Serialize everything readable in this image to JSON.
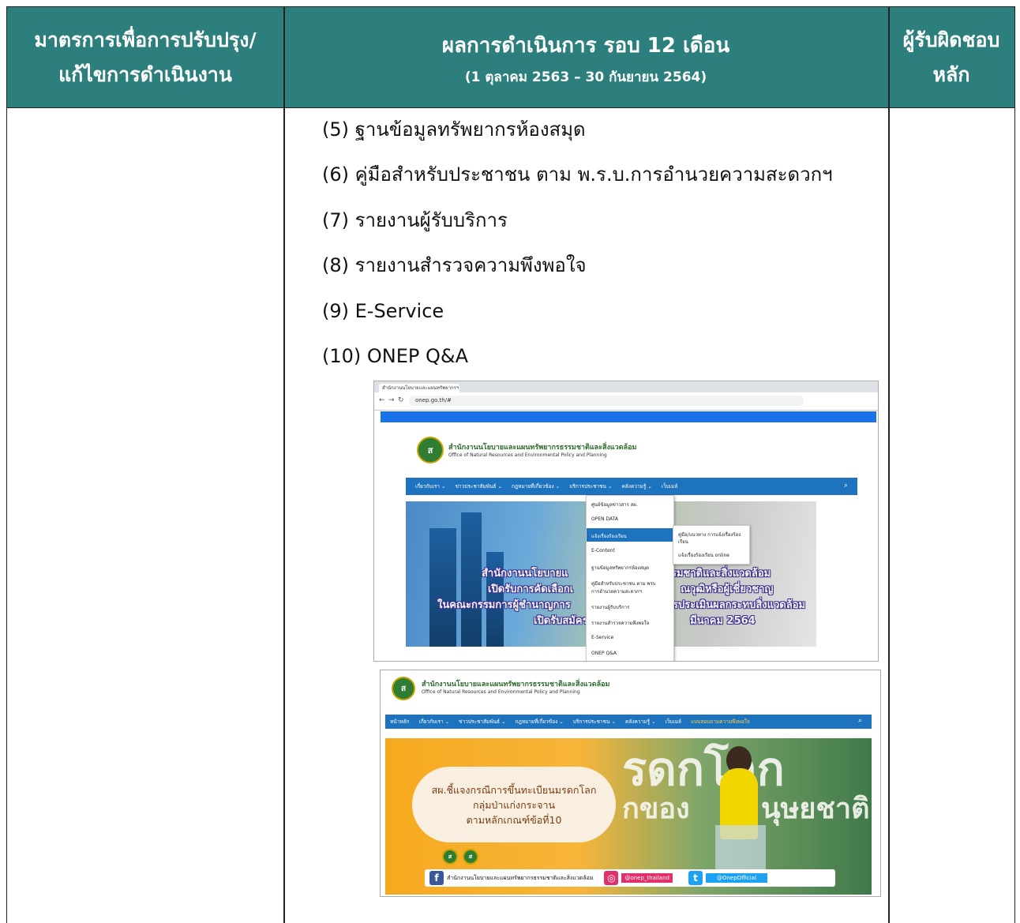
{
  "header": {
    "col1_line1": "มาตรการเพื่อการปรับปรุง/",
    "col1_line2": "แก้ไขการดำเนินงาน",
    "col2_title": "ผลการดำเนินการ รอบ 12 เดือน",
    "col2_sub": "(1 ตุลาคม 2563 – 30 กันยายน 2564)",
    "col3_line1": "ผู้รับผิดชอบ",
    "col3_line2": "หลัก"
  },
  "items": [
    "(5) ฐานข้อมูลทรัพยากรห้องสมุด",
    "(6) คู่มือสำหรับประชาชน ตาม พ.ร.บ.การอำนวยความสะดวกฯ",
    "(7) รายงานผู้รับบริการ",
    "(8) รายงานสำรวจความพึงพอใจ",
    "(9) E-Service",
    "(10) ONEP Q&A"
  ],
  "shot1": {
    "tab_title": "สำนักงานนโยบายและแผนทรัพยากรฯ",
    "url": "onep.go.th/#",
    "org_th": "สำนักงานนโยบายและแผนทรัพยากรธรรมชาติและสิ่งแวดล้อม",
    "org_en": "Office of Natural Resources and Environmental Policy and Planning",
    "menu": [
      "เกี่ยวกับเรา ⌄",
      "ข่าวประชาสัมพันธ์ ⌄",
      "กฎหมายที่เกี่ยวข้อง ⌄",
      "บริการประชาชน ⌄",
      "คลังความรู้ ⌄",
      "เว็บเมล์"
    ],
    "dropdown": [
      "ศูนย์ข้อมูลข่าวสาร สผ.",
      "OPEN DATA",
      "แจ้งเรื่องร้องเรียน",
      "E-Content",
      "ฐานข้อมูลทรัพยากรห้องสมุด",
      "คู่มือสำหรับประชาชน ตาม พรบ",
      "การอำนวยความสะดวกฯ",
      "รายงานผู้รับบริการ",
      "รายงานสำรวจความพึงพอใจ",
      "E-Service",
      "ONEP Q&A"
    ],
    "submenu": [
      "คู่มือ/แนวทาง การแจ้งเรื่องร้อง",
      "เรียน",
      "แจ้งเรื่องร้องเรียน online"
    ],
    "banner_lines": [
      "สำนักงานนโยบายแ",
      "เปิดรับการคัดเลือกเ",
      "ในคณะกรรมการผู้ชำนาญการ",
      "เปิดรับสมัคร",
      "รมชาติและสิ่งแวดล้อม",
      "ณวุฒิหรือผู้เชี่ยวชาญ",
      "รประเมินผลกระทบสิ่งแวดล้อม",
      "มีนาคม 2564"
    ]
  },
  "shot2": {
    "org_th": "สำนักงานนโยบายและแผนทรัพยากรธรรมชาติและสิ่งแวดล้อม",
    "org_en": "Office of Natural Resources and Environmental Policy and Planning",
    "menu": [
      "หน้าหลัก",
      "เกี่ยวกับเรา ⌄",
      "ข่าวประชาสัมพันธ์ ⌄",
      "กฎหมายที่เกี่ยวข้อง ⌄",
      "บริการประชาชน ⌄",
      "คลังความรู้ ⌄",
      "เว็บเมล์",
      "แบบสอบถามความพึงพอใจ"
    ],
    "bubble": [
      "สผ.ชี้แจงกรณีการขึ้นทะเบียนมรดกโลก",
      "กลุ่มป่าแก่งกระจาน",
      "ตามหลักเกณฑ์ข้อที่10"
    ],
    "bg_word1": "รดกโลก",
    "bg_word2": "กของ",
    "bg_word3": "นุษยชาติ",
    "fb_text": "สำนักงานนโยบายและแผนทรัพยากรธรรมชาติและสิ่งแวดล้อม",
    "ig_text": "@onep_thailand",
    "tw_text": "@OnepOfficial"
  },
  "colors": {
    "header_bg": "#2c7f7c",
    "menu_blue": "#1e73be"
  }
}
